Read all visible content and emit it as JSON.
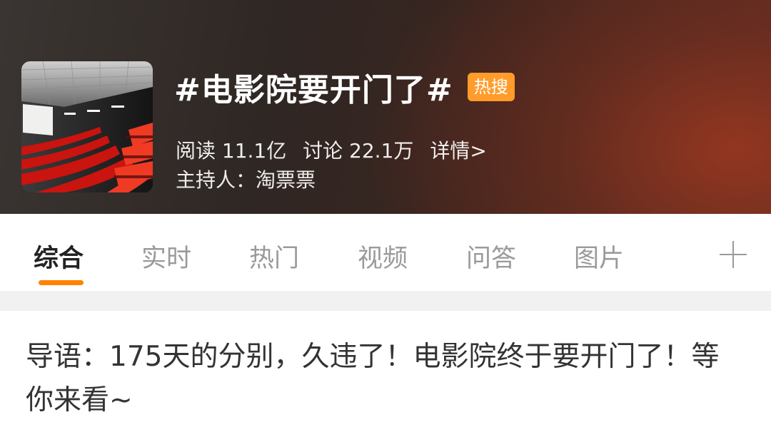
{
  "topic": {
    "title": "#电影院要开门了#",
    "badge": "热搜",
    "thumbnail_icon": "cinema-hall-image"
  },
  "stats": {
    "reads": "阅读 11.1亿",
    "discussions": "讨论 22.1万",
    "details_link": "详情>"
  },
  "host": "主持人：淘票票",
  "tabs": [
    {
      "label": "综合",
      "active": true
    },
    {
      "label": "实时",
      "active": false
    },
    {
      "label": "热门",
      "active": false
    },
    {
      "label": "视频",
      "active": false
    },
    {
      "label": "问答",
      "active": false
    },
    {
      "label": "图片",
      "active": false
    }
  ],
  "tabs_more_icon": "plus-icon",
  "intro": "导语：175天的分别，久违了！电影院终于要开门了！等你来看~",
  "colors": {
    "accent": "#ff8200",
    "badge": "#ff9c2b",
    "seat_red": "#e2231a"
  }
}
